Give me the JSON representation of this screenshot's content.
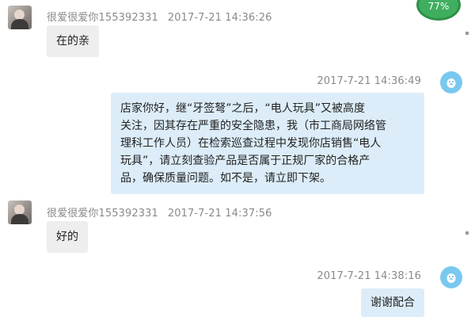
{
  "battery_badge": {
    "text": "77%",
    "color": "#3fae5e"
  },
  "messages": [
    {
      "direction": "incoming",
      "sender": "很爱很爱你155392331",
      "time": "2017-7-21 14:36:26",
      "text": "在的亲"
    },
    {
      "direction": "outgoing",
      "time": "2017-7-21 14:36:49",
      "lines": [
        "店家你好，继“牙签弩”之后，“电人玩具”又被高度",
        "关注，因其存在严重的安全隐患，我（市工商局网络管",
        "理科工作人员）在检索巡查过程中发现你店销售“电人",
        "玩具”，请立刻查验产品是否属于正规厂家的合格产",
        "品，确保质量问题。如不是，请立即下架。"
      ]
    },
    {
      "direction": "incoming",
      "sender": "很爱很爱你155392331",
      "time": "2017-7-21 14:37:56",
      "text": "好的"
    },
    {
      "direction": "outgoing",
      "time": "2017-7-21 14:38:16",
      "text": "谢谢配合"
    }
  ],
  "colors": {
    "incoming_bubble": "#eeeeee",
    "outgoing_bubble": "#dcedf9",
    "meta_text": "#8a8a8a",
    "qq_icon": "#79c8ef"
  }
}
